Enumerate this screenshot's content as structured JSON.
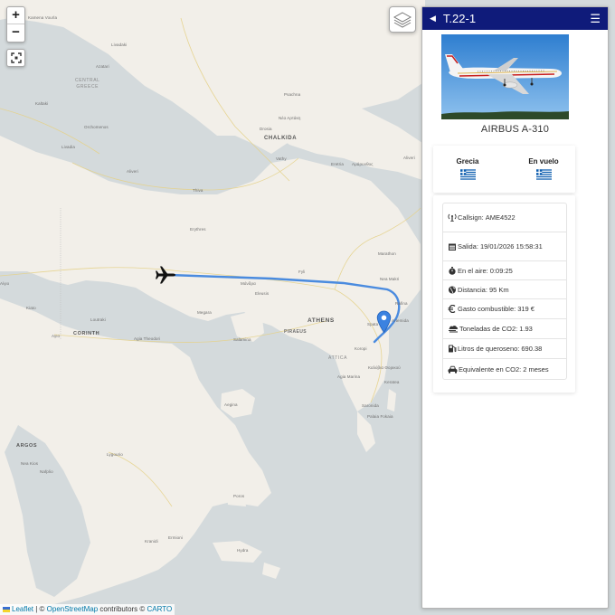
{
  "map": {
    "zoom_in_label": "+",
    "zoom_out_label": "−",
    "fullscreen_icon": "fullscreen-icon",
    "layers_icon": "layers-icon",
    "route_color": "#4a8bdf",
    "aircraft_icon": "airplane-icon",
    "destination_icon": "map-marker-icon",
    "places": [
      {
        "id": "kamena-vourla",
        "label": "Kamena Vourla"
      },
      {
        "id": "livadaki",
        "label": "Livadaki"
      },
      {
        "id": "azatari",
        "label": "Azatari"
      },
      {
        "id": "central-greece",
        "label": "CENTRAL\nGREECE"
      },
      {
        "id": "kaltaki",
        "label": "Kaltaki"
      },
      {
        "id": "orchomenos",
        "label": "Orchomenos"
      },
      {
        "id": "livadia",
        "label": "Livadia"
      },
      {
        "id": "aliveri-w",
        "label": "Aliveri"
      },
      {
        "id": "thiva",
        "label": "Thiva"
      },
      {
        "id": "erythres",
        "label": "Erythres"
      },
      {
        "id": "psachna",
        "label": "Psachna"
      },
      {
        "id": "nea-artaki",
        "label": "Νέα Αρτάκη"
      },
      {
        "id": "chalkida",
        "label": "CHALKIDA"
      },
      {
        "id": "drosia",
        "label": "Drosia"
      },
      {
        "id": "vathy",
        "label": "Vathy"
      },
      {
        "id": "eretria",
        "label": "Eretria"
      },
      {
        "id": "amarynthos",
        "label": "Αμάρυνθος"
      },
      {
        "id": "aliveri-e",
        "label": "Aliveri"
      },
      {
        "id": "marathon",
        "label": "Marathon"
      },
      {
        "id": "nea-makri",
        "label": "Nea Makri"
      },
      {
        "id": "fyli",
        "label": "Fyli"
      },
      {
        "id": "mandra",
        "label": "Μάνδρα"
      },
      {
        "id": "elefsina",
        "label": "Eleusis"
      },
      {
        "id": "megara",
        "label": "Megara"
      },
      {
        "id": "loutraki",
        "label": "Loutraki"
      },
      {
        "id": "corinth",
        "label": "CORINTH"
      },
      {
        "id": "agioi-theodoroi",
        "label": "Agia Theodori"
      },
      {
        "id": "athens",
        "label": "ATHENS"
      },
      {
        "id": "piraeus",
        "label": "PIRAEUS"
      },
      {
        "id": "rafina",
        "label": "Rafina"
      },
      {
        "id": "spata",
        "label": "Spata"
      },
      {
        "id": "artemida",
        "label": "Artemida"
      },
      {
        "id": "koropi",
        "label": "Koropi"
      },
      {
        "id": "attica",
        "label": "ATTICA"
      },
      {
        "id": "aigina",
        "label": "Aegina"
      },
      {
        "id": "salamina",
        "label": "Salamina"
      },
      {
        "id": "agia-marina",
        "label": "Agia Marina"
      },
      {
        "id": "kalyvia",
        "label": "Καλύβια Θορικού"
      },
      {
        "id": "keratea",
        "label": "Keratea"
      },
      {
        "id": "saronida",
        "label": "Saronida"
      },
      {
        "id": "palaia-fokaia",
        "label": "Palaia Fokaia"
      },
      {
        "id": "argos",
        "label": "ARGOS"
      },
      {
        "id": "nea-kios",
        "label": "Nea Kios"
      },
      {
        "id": "nafplio",
        "label": "Nafplio"
      },
      {
        "id": "lygourio",
        "label": "Lygourio"
      },
      {
        "id": "poros",
        "label": "Poros"
      },
      {
        "id": "kranidi",
        "label": "Kranidi"
      },
      {
        "id": "ermioni",
        "label": "Ermioni"
      },
      {
        "id": "hydra",
        "label": "Hydra"
      },
      {
        "id": "kiato",
        "label": "Kiato"
      },
      {
        "id": "aigio",
        "label": "Αίγιο"
      },
      {
        "id": "krestena",
        "label": "Kiato"
      }
    ],
    "attribution": {
      "leaflet": "Leaflet",
      "sep1": " | © ",
      "osm": "OpenStreetMap",
      "contributors": " contributors © ",
      "carto": "CARTO"
    }
  },
  "sidebar": {
    "title": "T.22-1",
    "back_icon": "caret-left-icon",
    "menu_icon": "hamburger-menu-icon",
    "aircraft_model": "AIRBUS A-310",
    "origin": {
      "label": "Grecia",
      "flag": "greece-flag"
    },
    "status": {
      "label": "En vuelo",
      "flag": "greece-flag"
    },
    "details": [
      {
        "icon": "antenna-icon",
        "key": "Callsign:",
        "value": "AME4522"
      },
      {
        "icon": "calendar-icon",
        "key": "Salida:",
        "value": "19/01/2026 15:58:31"
      },
      {
        "icon": "stopwatch-icon",
        "key": "En el aire:",
        "value": "0:09:25"
      },
      {
        "icon": "globe-icon",
        "key": "Distancia:",
        "value": "95 Km"
      },
      {
        "icon": "euro-icon",
        "key": "Gasto combustible:",
        "value": "319 €"
      },
      {
        "icon": "smog-icon",
        "key": "Toneladas de CO2:",
        "value": "1.93"
      },
      {
        "icon": "gas-pump-icon",
        "key": "Litros de queroseno:",
        "value": "690.38"
      },
      {
        "icon": "car-icon",
        "key": "Equivalente en CO2:",
        "value": "2 meses"
      }
    ]
  },
  "colors": {
    "header_bg": "#0f1b7a",
    "sea": "#d4dadc",
    "land": "#f2efe9"
  }
}
